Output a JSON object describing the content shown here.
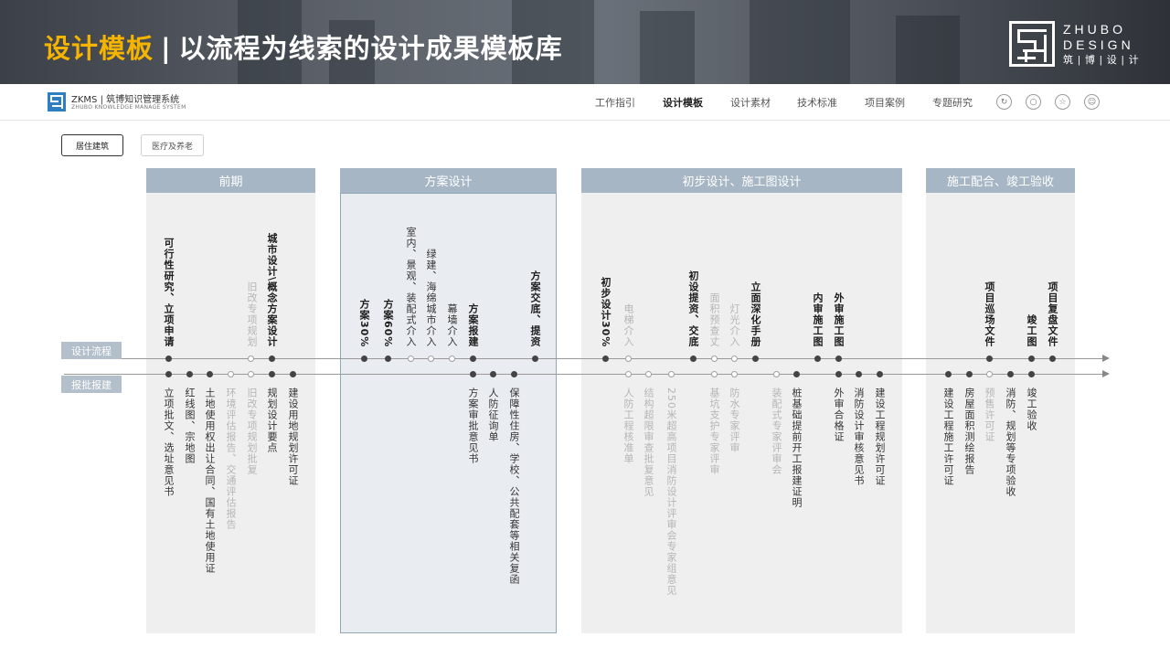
{
  "banner": {
    "title_accent": "设计模板",
    "separator": "|",
    "title_rest": "以流程为线索的设计成果模板库"
  },
  "brand": {
    "line1": "ZHUBO",
    "line2": "DESIGN",
    "line3": "筑|博|设|计"
  },
  "nav": {
    "system_title": "ZKMS | 筑博知识管理系统",
    "system_subtitle": "ZHUBO KNOWLEDGE MANAGE SYSTEM",
    "items": [
      {
        "label": "工作指引",
        "active": false
      },
      {
        "label": "设计模板",
        "active": true
      },
      {
        "label": "设计素材",
        "active": false
      },
      {
        "label": "技术标准",
        "active": false
      },
      {
        "label": "项目案例",
        "active": false
      },
      {
        "label": "专题研究",
        "active": false
      }
    ],
    "icons": [
      "share-icon",
      "search-icon",
      "star-icon",
      "user-icon"
    ]
  },
  "filters": [
    {
      "label": "居住建筑",
      "selected": true
    },
    {
      "label": "医疗及养老",
      "selected": false
    }
  ],
  "rows": {
    "design_flow": "设计流程",
    "approval": "报批报建"
  },
  "phases": [
    {
      "name": "前期",
      "selected": false
    },
    {
      "name": "方案设计",
      "selected": true
    },
    {
      "name": "初步设计、施工图设计",
      "selected": false
    },
    {
      "name": "施工配合、竣工验收",
      "selected": false
    }
  ],
  "design_items": [
    {
      "label": "可行性研究、立项申请",
      "style": "bold"
    },
    {
      "label": "旧改专项规划",
      "style": "gray"
    },
    {
      "label": "城市设计\\概念方案设计",
      "style": "bold"
    },
    {
      "label": "方案30%",
      "style": "bold"
    },
    {
      "label": "方案60%",
      "style": "bold"
    },
    {
      "label": "室内、景观、装配式介入",
      "style": "normal"
    },
    {
      "label": "绿建、海绵城市介入",
      "style": "normal"
    },
    {
      "label": "幕墙介入",
      "style": "normal"
    },
    {
      "label": "方案报建",
      "style": "bold"
    },
    {
      "label": "方案交底、提资",
      "style": "bold"
    },
    {
      "label": "初步设计30%",
      "style": "bold"
    },
    {
      "label": "电梯介入",
      "style": "gray"
    },
    {
      "label": "初设提资、交底",
      "style": "bold"
    },
    {
      "label": "面积预查丈",
      "style": "gray"
    },
    {
      "label": "灯光介入",
      "style": "gray"
    },
    {
      "label": "立面深化手册",
      "style": "bold"
    },
    {
      "label": "内审施工图",
      "style": "bold"
    },
    {
      "label": "外审施工图",
      "style": "bold"
    },
    {
      "label": "项目巡场文件",
      "style": "bold"
    },
    {
      "label": "竣工图",
      "style": "bold"
    },
    {
      "label": "项目复盘文件",
      "style": "bold"
    }
  ],
  "approval_items": [
    {
      "label": "立项批文、选址意见书",
      "style": "normal"
    },
    {
      "label": "红线图、宗地图",
      "style": "normal"
    },
    {
      "label": "土地使用权出让合同、国有土地使用证",
      "style": "normal"
    },
    {
      "label": "环境评估报告、交通评估报告",
      "style": "gray"
    },
    {
      "label": "旧改专项规划批复",
      "style": "gray"
    },
    {
      "label": "规划设计要点",
      "style": "normal"
    },
    {
      "label": "建设用地规划许可证",
      "style": "normal"
    },
    {
      "label": "方案审批意见书",
      "style": "normal"
    },
    {
      "label": "人防征询单",
      "style": "normal"
    },
    {
      "label": "保障性住房、学校、公共配套等相关复函",
      "style": "normal"
    },
    {
      "label": "人防工程核准单",
      "style": "gray"
    },
    {
      "label": "结构超限审查批复意见",
      "style": "gray"
    },
    {
      "label": "250米超高项目消防设计评审会专家组意见",
      "style": "gray"
    },
    {
      "label": "基坑支护专家评审",
      "style": "gray"
    },
    {
      "label": "防水专家评审",
      "style": "gray"
    },
    {
      "label": "装配式专家评审会",
      "style": "gray"
    },
    {
      "label": "桩基础提前开工报建证明",
      "style": "normal"
    },
    {
      "label": "外审合格证",
      "style": "normal"
    },
    {
      "label": "消防设计审核意见书",
      "style": "normal"
    },
    {
      "label": "建设工程规划许可证",
      "style": "normal"
    },
    {
      "label": "建设工程施工许可证",
      "style": "normal"
    },
    {
      "label": "房屋面积测绘报告",
      "style": "normal"
    },
    {
      "label": "预售许可证",
      "style": "gray"
    },
    {
      "label": "消防、规划等专项验收",
      "style": "normal"
    },
    {
      "label": "竣工验收",
      "style": "normal"
    }
  ]
}
